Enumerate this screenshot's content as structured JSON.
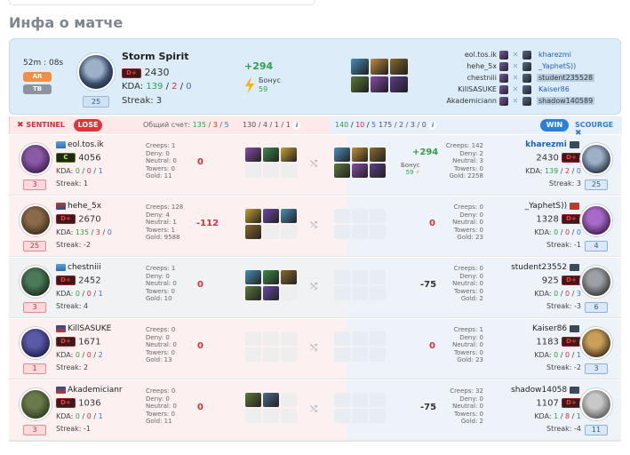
{
  "section_title": "Инфа о матче",
  "summary": {
    "duration": "52m : 08s",
    "mode_tags": [
      "AR",
      "TB"
    ],
    "level": "25",
    "name": "Storm Spirit",
    "rank_badge": "D+",
    "rating": "2430",
    "kda_label": "KDA:",
    "kda_k": "139",
    "kda_d": "2",
    "kda_a": "0",
    "streak": "Streak: 3",
    "gain": "+294",
    "bonus_label": "Бонус",
    "bonus_value": "59",
    "items": [
      "#4a8fb8",
      "#c58c35",
      "#8a6a2e",
      "#5d7a3a",
      "#8a4aa8",
      "#5a3d8a"
    ],
    "players": [
      {
        "left": "eol.tos.ik",
        "right": "kharezmi",
        "highlight": false
      },
      {
        "left": "hehe_5x",
        "right": "_YaphetS))",
        "highlight": false
      },
      {
        "left": "chestniii",
        "right": "student235528",
        "highlight": true
      },
      {
        "left": "KillSASUKE",
        "right": "Kaiser86",
        "highlight": false
      },
      {
        "left": "Akademiciann",
        "right": "shadow140589",
        "highlight": true
      }
    ]
  },
  "teams": {
    "left_name": "SENTINEL",
    "left_result": "LOSE",
    "score_label": "Общий счет:",
    "score_k": "135",
    "score_d": "3",
    "score_a": "5",
    "left_totals": "130 / 4 / 1 / 1",
    "right_k": "140",
    "right_d": "10",
    "right_a": "5",
    "right_totals": "175 / 2 / 3 / 0",
    "right_result": "WIN",
    "right_name": "SCOURGE"
  },
  "rows": [
    {
      "l": {
        "name": "eol.tos.ik",
        "rank": "C",
        "rating": "4056",
        "kda": [
          "0",
          "0",
          "1"
        ],
        "streak": "Streak: 1",
        "level": "3",
        "stats": [
          "Creeps: 1",
          "Deny: 0",
          "Neutral: 0",
          "Towers: 0",
          "Gold: 11"
        ],
        "delta": "0",
        "items": [
          "#8a4aa8",
          "#3d8a4a",
          "#c5a035"
        ]
      },
      "r": {
        "name": "kharezmi",
        "rank": "D+",
        "rating": "2430",
        "kda": [
          "139",
          "2",
          "0"
        ],
        "streak": "Streak: 3",
        "level": "25",
        "stats": [
          "Creeps: 142",
          "Deny: 2",
          "Neutral: 3",
          "Towers: 0",
          "Gold: 2258"
        ],
        "delta": "+294",
        "bonus_label": "Бонус",
        "bonus_value": "59",
        "items": [
          "#4a8fb8",
          "#c58c35",
          "#8a6a2e",
          "#5d7a3a",
          "#8a4aa8",
          "#5a3d8a"
        ]
      }
    },
    {
      "l": {
        "name": "hehe_5x",
        "rank": "D+",
        "rating": "2670",
        "kda": [
          "135",
          "3",
          "0"
        ],
        "streak": "Streak: -2",
        "level": "25",
        "stats": [
          "Creeps: 128",
          "Deny: 4",
          "Neutral: 1",
          "Towers: 1",
          "Gold: 9588"
        ],
        "delta": "-112",
        "items": [
          "#c5a035",
          "#6a4aa8",
          "#4a8fb8",
          "#8a6a2e"
        ]
      },
      "r": {
        "name": "_YaphetS))",
        "rank": "D+",
        "rating": "1328",
        "kda": [
          "0",
          "0",
          "0"
        ],
        "streak": "Streak: -1",
        "level": "4",
        "stats": [
          "Creeps: 0",
          "Deny: 0",
          "Neutral: 0",
          "Towers: 0",
          "Gold: 23"
        ],
        "delta": "0",
        "items": []
      }
    },
    {
      "l": {
        "name": "chestniii",
        "rank": "D+",
        "rating": "2452",
        "kda": [
          "0",
          "0",
          "1"
        ],
        "streak": "Streak: 4",
        "level": "3",
        "stats": [
          "Creeps: 1",
          "Deny: 0",
          "Neutral: 0",
          "Towers: 0",
          "Gold: 10"
        ],
        "delta": "0",
        "items": [
          "#4a8fb8",
          "#3d8a4a",
          "#8a6a2e",
          "#5d7a3a",
          "#6a4aa8"
        ]
      },
      "r": {
        "name": "student23552",
        "rank": "D+",
        "rating": "925",
        "kda": [
          "0",
          "0",
          "3"
        ],
        "streak": "Streak: -3",
        "level": "6",
        "stats": [
          "Creeps: 0",
          "Deny: 0",
          "Neutral: 0",
          "Towers: 0",
          "Gold: 2"
        ],
        "delta": "-75",
        "items": []
      }
    },
    {
      "l": {
        "name": "KillSASUKE",
        "rank": "D+",
        "rating": "1671",
        "kda": [
          "0",
          "0",
          "2"
        ],
        "streak": "Streak: 2",
        "level": "1",
        "stats": [
          "Creeps: 0",
          "Deny: 0",
          "Neutral: 0",
          "Towers: 0",
          "Gold: 13"
        ],
        "delta": "0",
        "items": []
      },
      "r": {
        "name": "Kaiser86",
        "rank": "D+",
        "rating": "1183",
        "kda": [
          "0",
          "0",
          "1"
        ],
        "streak": "Streak: -2",
        "level": "3",
        "stats": [
          "Creeps: 1",
          "Deny: 0",
          "Neutral: 0",
          "Towers: 0",
          "Gold: 23"
        ],
        "delta": "0",
        "items": []
      }
    },
    {
      "l": {
        "name": "Akademicianr",
        "rank": "D+",
        "rating": "1036",
        "kda": [
          "0",
          "0",
          "1"
        ],
        "streak": "Streak: -1",
        "level": "3",
        "stats": [
          "Creeps: 0",
          "Deny: 0",
          "Neutral: 0",
          "Towers: 0",
          "Gold: 11"
        ],
        "delta": "0",
        "items": [
          "#5d7a3a",
          "#4a6a8a"
        ]
      },
      "r": {
        "name": "shadow14058",
        "rank": "D+",
        "rating": "1107",
        "kda": [
          "1",
          "8",
          "1"
        ],
        "streak": "Streak: -4",
        "level": "11",
        "stats": [
          "Creeps: 32",
          "Deny: 0",
          "Neutral: 0",
          "Towers: 0",
          "Gold: 2"
        ],
        "delta": "-75",
        "items": []
      }
    }
  ]
}
